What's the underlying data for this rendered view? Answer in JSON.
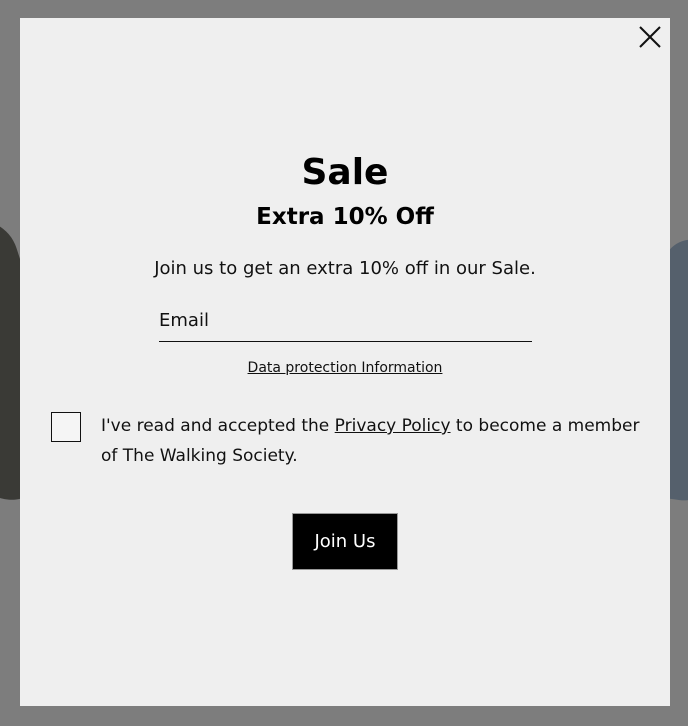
{
  "popup": {
    "title": "Sale",
    "subtitle": "Extra 10% Off",
    "description": "Join us to get an extra 10% off in our Sale.",
    "email_placeholder": "Email",
    "email_value": "",
    "data_protection_link": "Data protection Information",
    "consent": {
      "prefix": "I've read and accepted the ",
      "link": "Privacy Policy",
      "suffix": " to become a member of The Walking Society.",
      "checked": false
    },
    "join_button": "Join Us",
    "close_icon": "close-icon"
  },
  "colors": {
    "backdrop": "#7d7d7d",
    "modal_background": "#efefef",
    "button_background": "#000000",
    "button_text": "#ffffff",
    "text": "#111111"
  }
}
